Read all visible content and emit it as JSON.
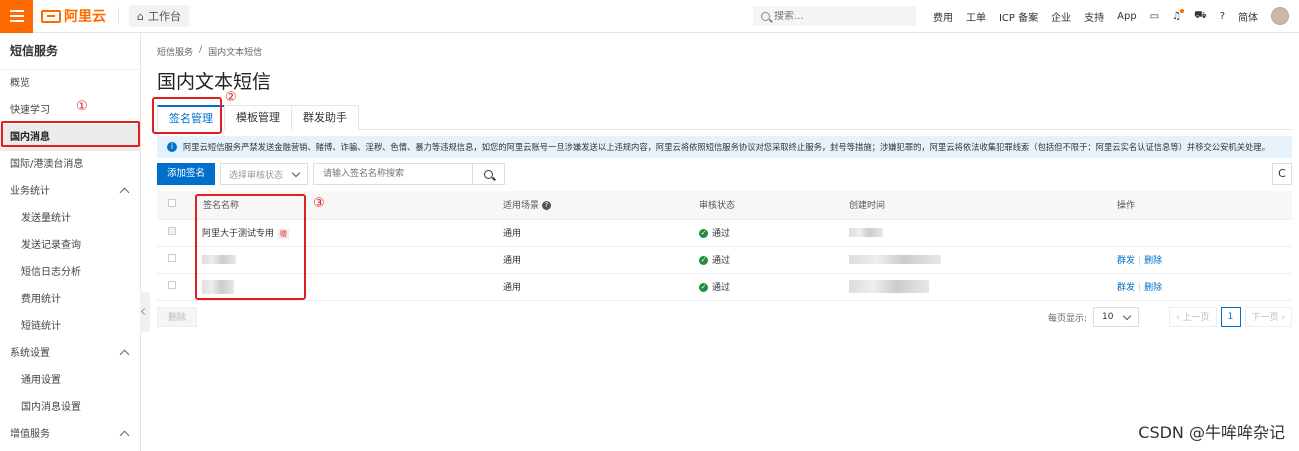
{
  "topbar": {
    "brand": "阿里云",
    "workbench": "工作台",
    "search_placeholder": "搜索...",
    "links": [
      "费用",
      "工单",
      "ICP 备案",
      "企业",
      "支持",
      "App"
    ],
    "lang": "简体"
  },
  "sidebar": {
    "title": "短信服务",
    "items": [
      {
        "label": "概览"
      },
      {
        "label": "快速学习"
      },
      {
        "label": "国内消息"
      },
      {
        "label": "国际/港澳台消息"
      },
      {
        "label": "业务统计"
      },
      {
        "label": "发送量统计"
      },
      {
        "label": "发送记录查询"
      },
      {
        "label": "短信日志分析"
      },
      {
        "label": "费用统计"
      },
      {
        "label": "短链统计"
      },
      {
        "label": "系统设置"
      },
      {
        "label": "通用设置"
      },
      {
        "label": "国内消息设置"
      },
      {
        "label": "增值服务"
      }
    ]
  },
  "annotations": {
    "one": "①",
    "two": "②",
    "three": "③"
  },
  "breadcrumb": {
    "root": "短信服务",
    "sep": "/",
    "current": "国内文本短信"
  },
  "page_title": "国内文本短信",
  "tabs": [
    "签名管理",
    "模板管理",
    "群发助手"
  ],
  "notice": "阿里云短信服务严禁发送金融营销、赌博、诈骗、淫秽、色情、暴力等违规信息，如您的阿里云账号一旦涉嫌发送以上违规内容，阿里云将依照短信服务协议对您采取终止服务，封号等措施；涉嫌犯罪的，阿里云将依法收集犯罪线索（包括但不限于：阿里云实名认证信息等）并移交公安机关处理。",
  "toolbar": {
    "add_label": "添加签名",
    "status_placeholder": "选择审核状态",
    "keyword_placeholder": "请输入签名名称搜索",
    "refresh": "C"
  },
  "table": {
    "headers": {
      "name": "签名名称",
      "scene": "适用场景",
      "status": "审核状态",
      "created": "创建时间",
      "ops": "操作"
    },
    "rows": [
      {
        "name": "阿里大于测试专用",
        "tag": "赠",
        "scene": "通用",
        "status": "通过",
        "ops": []
      },
      {
        "name": "",
        "tag": "",
        "scene": "通用",
        "status": "通过",
        "ops": [
          "群发",
          "删除"
        ]
      },
      {
        "name": "",
        "tag": "",
        "scene": "通用",
        "status": "通过",
        "ops": [
          "群发",
          "删除"
        ]
      }
    ]
  },
  "footer": {
    "delete_label": "删除",
    "page_size_label": "每页显示:",
    "page_size": "10",
    "prev": "上一页",
    "page": "1",
    "next": "下一页"
  },
  "watermark": "CSDN @牛哞哞杂记"
}
